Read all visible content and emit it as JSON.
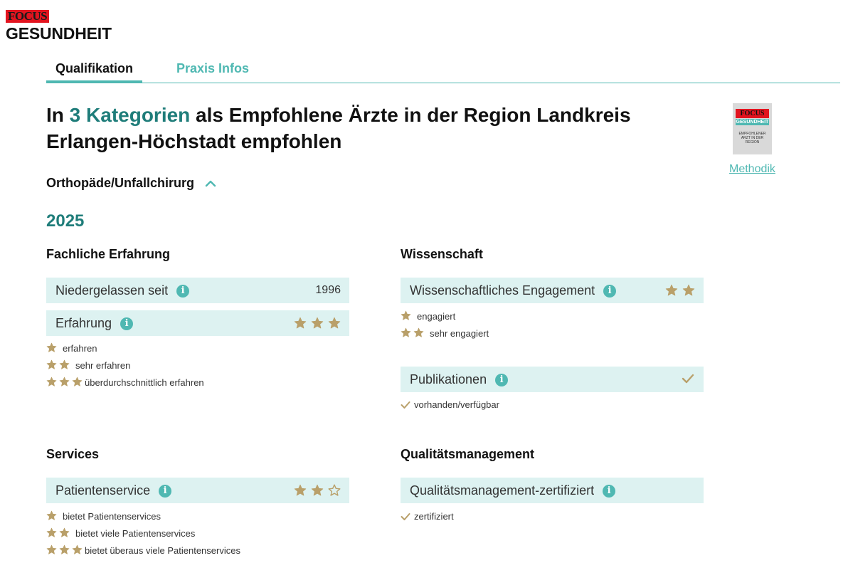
{
  "brand": {
    "logo_top": "FOCUS",
    "logo_bottom": "GESUNDHEIT"
  },
  "tabs": [
    {
      "label": "Qualifikation",
      "active": true
    },
    {
      "label": "Praxis Infos",
      "active": false
    }
  ],
  "heading": {
    "prefix": "In ",
    "highlight": "3 Kategorien",
    "line1_rest": " als Empfohlene Ärzte in der Region Landkreis",
    "line2": "Erlangen-Höchstadt empfohlen"
  },
  "badge": {
    "top": "FOCUS",
    "sub": "GESUNDHEIT",
    "text": "EMPFOHLENER ARZT IN DER REGION",
    "link": "Methodik"
  },
  "category": {
    "label": "Orthopäde/Unfallchirurg",
    "icon": "chevron-up-icon"
  },
  "year": "2025",
  "colors": {
    "accent": "#4fb8b2",
    "accent_dark": "#1f7d7a",
    "star": "#b9a06a",
    "row_bg": "#ddf2f1"
  },
  "sections": {
    "fachliche": {
      "title": "Fachliche Erfahrung",
      "niedergelassen": {
        "label": "Niedergelassen seit",
        "value": "1996"
      },
      "erfahrung": {
        "label": "Erfahrung",
        "rating": 3,
        "max": 3
      },
      "legend": [
        "erfahren",
        "sehr erfahren",
        "überdurchschnittlich erfahren"
      ]
    },
    "wissenschaft": {
      "title": "Wissenschaft",
      "engagement": {
        "label": "Wissenschaftliches Engagement",
        "rating": 2,
        "max": 2
      },
      "engagement_legend": [
        "engagiert",
        "sehr engagiert"
      ],
      "publikationen": {
        "label": "Publikationen",
        "status": "check-icon"
      },
      "publikationen_legend": "vorhanden/verfügbar"
    },
    "services": {
      "title": "Services",
      "patientenservice": {
        "label": "Patientenservice",
        "rating": 2,
        "max": 3
      },
      "legend": [
        "bietet Patientenservices",
        "bietet viele Patientenservices",
        "bietet überaus viele Patientenservices"
      ]
    },
    "qualitaet": {
      "title": "Qualitätsmanagement",
      "zertifiziert": {
        "label": "Qualitätsmanagement-zertifiziert"
      },
      "legend": "zertifiziert"
    }
  }
}
